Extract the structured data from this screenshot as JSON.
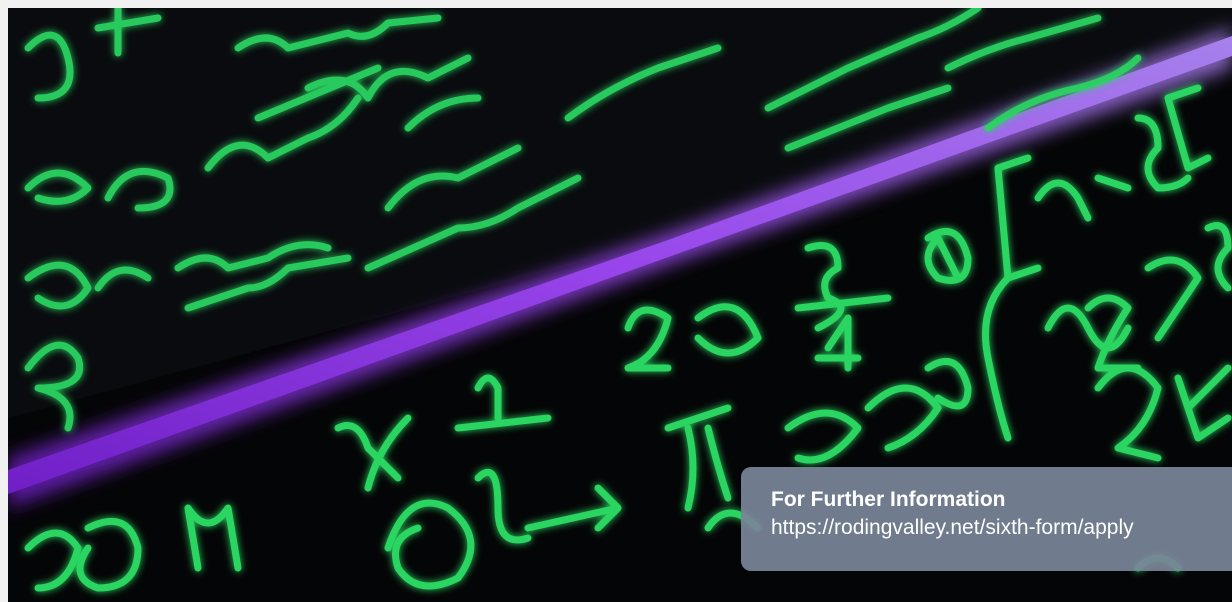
{
  "hero_image": {
    "icon": "glowing-math-chalkboard-image",
    "colors": {
      "board": "#050607",
      "chalk": "#2fe86a",
      "neon": "#9b3cf0"
    }
  },
  "info_card": {
    "heading": "For Further Information",
    "link": "https://rodingvalley.net/sixth-form/apply"
  },
  "colors": {
    "page_background": "#f1f1f2",
    "card_background": "#7884985e",
    "card_text": "#ffffff"
  }
}
